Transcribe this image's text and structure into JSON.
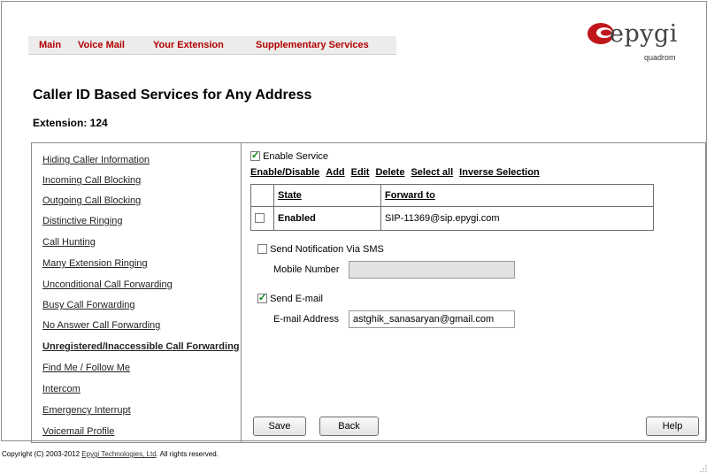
{
  "nav": {
    "items": [
      "Main",
      "Voice Mail",
      "Your Extension",
      "Supplementary Services"
    ]
  },
  "logo": {
    "word": "epygi",
    "sub": "quadrom"
  },
  "page": {
    "title": "Caller ID Based Services for Any Address",
    "extension": "Extension: 124"
  },
  "sidebar": {
    "items": [
      "Hiding Caller Information",
      "Incoming Call Blocking",
      "Outgoing Call Blocking",
      "Distinctive Ringing",
      "Call Hunting",
      "Many Extension Ringing",
      "Unconditional Call Forwarding",
      "Busy Call Forwarding",
      "No Answer Call Forwarding",
      "Unregistered/Inaccessible Call Forwarding",
      "Find Me / Follow Me",
      "Intercom",
      "Emergency Interrupt",
      "Voicemail Profile"
    ],
    "active": "Unregistered/Inaccessible Call Forwarding"
  },
  "service": {
    "enable_label": "Enable Service",
    "enabled": true
  },
  "actions": [
    "Enable/Disable",
    "Add",
    "Edit",
    "Delete",
    "Select all",
    "Inverse Selection"
  ],
  "table": {
    "headers": [
      "State",
      "Forward to"
    ],
    "rows": [
      {
        "state": "Enabled",
        "forward_to": "SIP-11369@sip.epygi.com",
        "selected": false
      }
    ]
  },
  "sms": {
    "label": "Send Notification Via SMS",
    "checked": false,
    "mobile_label": "Mobile Number",
    "mobile_value": ""
  },
  "email": {
    "label": "Send E-mail",
    "checked": true,
    "address_label": "E-mail Address",
    "address_value": "astghik_sanasaryan@gmail.com"
  },
  "buttons": {
    "save": "Save",
    "back": "Back",
    "help": "Help"
  },
  "footer": {
    "prefix": "Copyright (C) 2003-2012 ",
    "company": "Epygi Technologies, Ltd",
    "suffix": ". All rights reserved."
  },
  "colors": {
    "nav_text": "#b30000",
    "check": "#008000",
    "logo_red": "#c0161b"
  }
}
